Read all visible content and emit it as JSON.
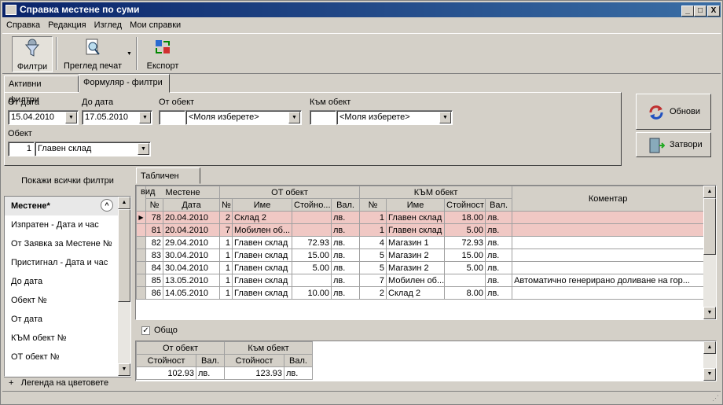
{
  "window": {
    "title": "Справка местене по суми",
    "min": "_",
    "max": "□",
    "close": "X"
  },
  "menu": [
    "Справка",
    "Редакция",
    "Изглед",
    "Мои справки"
  ],
  "toolbar": {
    "filters": "Филтри",
    "print_preview": "Преглед печат",
    "export": "Експорт"
  },
  "tabs": {
    "active_filters": "Активни филтри",
    "form_filters": "Формуляр - филтри"
  },
  "filters": {
    "from_date_label": "От дата",
    "from_date": "15.04.2010",
    "to_date_label": "До дата",
    "to_date": "17.05.2010",
    "from_object_label": "От обект",
    "from_object_placeholder": "<Моля изберете>",
    "to_object_label": "Към обект",
    "to_object_placeholder": "<Моля изберете>",
    "object_label": "Обект",
    "object_code": "1",
    "object_name": "Главен склад"
  },
  "buttons": {
    "refresh": "Обнови",
    "close": "Затвори"
  },
  "left": {
    "show_all": "Покажи всички филтри",
    "header": "Местене*",
    "items": [
      "Изпратен - Дата и час",
      "От Заявка за Местене №",
      "Пристигнал - Дата и час",
      "До дата",
      "Обект №",
      "От дата",
      "КЪМ обект №",
      "ОТ обект №"
    ],
    "legend": "Легенда на цветовете"
  },
  "grid": {
    "tab": "Табличен вид",
    "groups": {
      "move": "Местене",
      "from": "ОТ обект",
      "to": "КЪМ обект",
      "comment": "Коментар"
    },
    "cols": {
      "no": "№",
      "date": "Дата",
      "fno": "№",
      "fname": "Име",
      "fval": "Стойно...",
      "fcur": "Вал.",
      "tno": "№",
      "tname": "Име",
      "tval": "Стойност",
      "tcur": "Вал."
    },
    "rows": [
      {
        "no": "78",
        "date": "20.04.2010",
        "fno": "2",
        "fname": "Склад 2",
        "fval": "",
        "fcur": "лв.",
        "tno": "1",
        "tname": "Главен склад",
        "tval": "18.00",
        "tcur": "лв.",
        "comment": "",
        "pink": true,
        "current": true
      },
      {
        "no": "81",
        "date": "20.04.2010",
        "fno": "7",
        "fname": "Мобилен об...",
        "fval": "",
        "fcur": "лв.",
        "tno": "1",
        "tname": "Главен склад",
        "tval": "5.00",
        "tcur": "лв.",
        "comment": "",
        "pink": true
      },
      {
        "no": "82",
        "date": "29.04.2010",
        "fno": "1",
        "fname": "Главен склад",
        "fval": "72.93",
        "fcur": "лв.",
        "tno": "4",
        "tname": "Магазин 1",
        "tval": "72.93",
        "tcur": "лв.",
        "comment": ""
      },
      {
        "no": "83",
        "date": "30.04.2010",
        "fno": "1",
        "fname": "Главен склад",
        "fval": "15.00",
        "fcur": "лв.",
        "tno": "5",
        "tname": "Магазин 2",
        "tval": "15.00",
        "tcur": "лв.",
        "comment": ""
      },
      {
        "no": "84",
        "date": "30.04.2010",
        "fno": "1",
        "fname": "Главен склад",
        "fval": "5.00",
        "fcur": "лв.",
        "tno": "5",
        "tname": "Магазин 2",
        "tval": "5.00",
        "tcur": "лв.",
        "comment": ""
      },
      {
        "no": "85",
        "date": "13.05.2010",
        "fno": "1",
        "fname": "Главен склад",
        "fval": "",
        "fcur": "лв.",
        "tno": "7",
        "tname": "Мобилен об...",
        "tval": "",
        "tcur": "лв.",
        "comment": "Автоматично генерирано доливане на гор..."
      },
      {
        "no": "86",
        "date": "14.05.2010",
        "fno": "1",
        "fname": "Главен склад",
        "fval": "10.00",
        "fcur": "лв.",
        "tno": "2",
        "tname": "Склад 2",
        "tval": "8.00",
        "tcur": "лв.",
        "comment": ""
      }
    ]
  },
  "totals": {
    "checkbox": "Общо",
    "from": "От обект",
    "to": "Към обект",
    "value": "Стойност",
    "cur": "Вал.",
    "from_value": "102.93",
    "from_cur": "лв.",
    "to_value": "123.93",
    "to_cur": "лв."
  }
}
